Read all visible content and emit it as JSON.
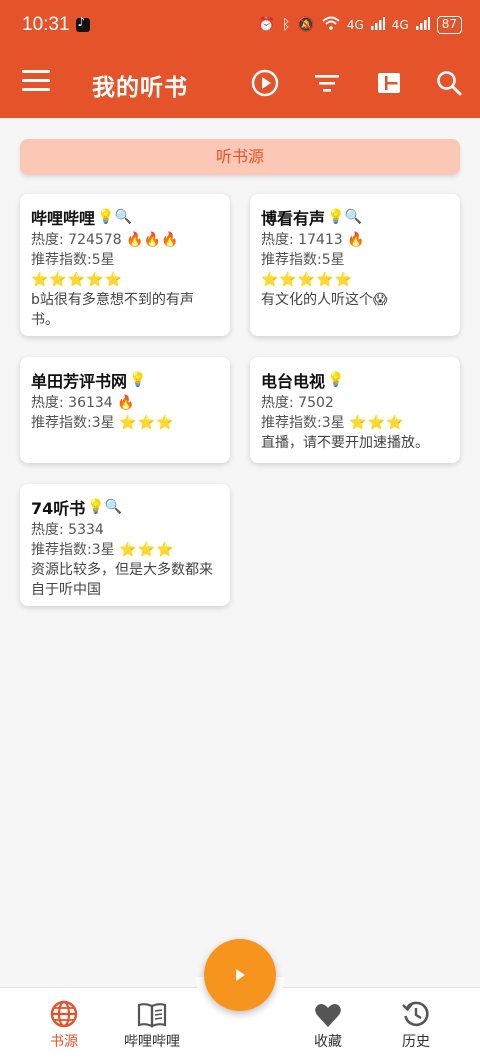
{
  "status_bar": {
    "time": "10:31",
    "network": "4G",
    "network2": "4G",
    "battery": "87"
  },
  "app_bar": {
    "title": "我的听书"
  },
  "section": {
    "title": "听书源"
  },
  "sources": [
    {
      "name": "哔哩哔哩",
      "icons": "💡🔍",
      "heat_label": "热度: 724578",
      "fire": "🔥🔥🔥",
      "rating_label": "推荐指数:5星",
      "stars": "⭐⭐⭐⭐⭐",
      "desc": " b站很有多意想不到的有声书。"
    },
    {
      "name": "博看有声",
      "icons": "💡🔍",
      "heat_label": "热度: 17413",
      "fire": "🔥",
      "rating_label": "推荐指数:5星",
      "stars": "⭐⭐⭐⭐⭐",
      "desc": "有文化的人听这个😱"
    },
    {
      "name": "单田芳评书网",
      "icons": "💡",
      "heat_label": "热度: 36134",
      "fire": "🔥",
      "rating_label": "推荐指数:3星",
      "stars": "⭐⭐⭐",
      "desc": ""
    },
    {
      "name": "电台电视",
      "icons": "💡",
      "heat_label": "热度: 7502",
      "fire": "",
      "rating_label": "推荐指数:3星",
      "stars": "⭐⭐⭐",
      "desc": "直播，请不要开加速播放。"
    },
    {
      "name": "74听书",
      "icons": "💡🔍",
      "heat_label": "热度: 5334",
      "fire": "",
      "rating_label": "推荐指数:3星",
      "stars": "⭐⭐⭐",
      "desc": "资源比较多，但是大多数都来自于听中国"
    }
  ],
  "bottom_nav": {
    "items": [
      {
        "label": "书源",
        "icon": "globe-icon",
        "active": true
      },
      {
        "label": "哔哩哔哩",
        "icon": "book-icon",
        "active": false
      },
      {
        "label": "收藏",
        "icon": "heart-icon",
        "active": false
      },
      {
        "label": "历史",
        "icon": "history-icon",
        "active": false
      }
    ]
  },
  "colors": {
    "primary": "#e5532b",
    "section_bg": "#fcc8b6",
    "fab": "#f7941d"
  }
}
